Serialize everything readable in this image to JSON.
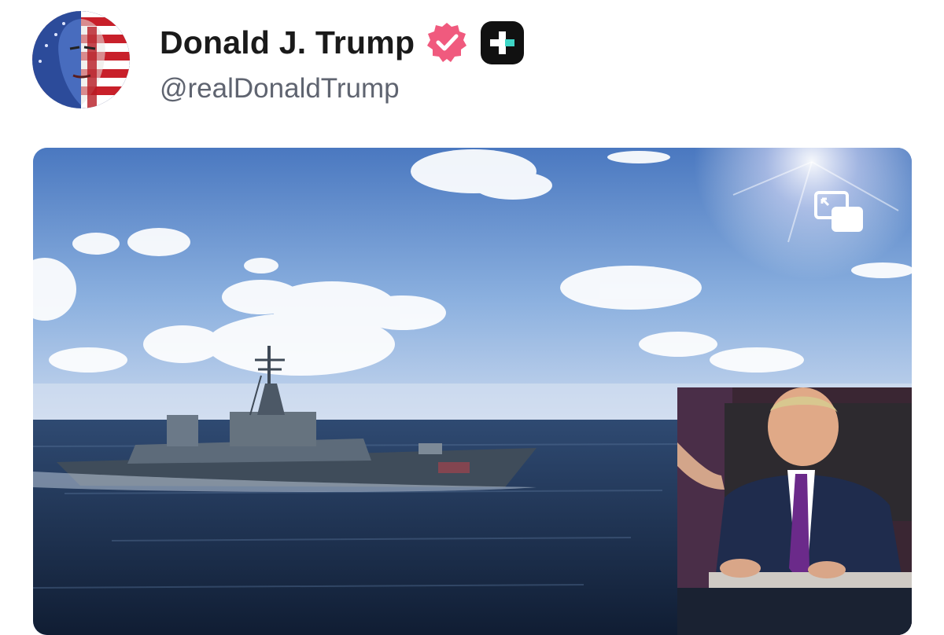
{
  "post": {
    "author": {
      "display_name": "Donald J. Trump",
      "handle": "@realDonaldTrump",
      "verified": true,
      "avatar_icon": "flag-portrait-avatar",
      "badge_icon": "truth-plus-icon"
    },
    "media": {
      "type": "video",
      "pip_icon": "picture-in-picture-icon"
    }
  },
  "colors": {
    "verified_badge": "#f05a7e",
    "name_text": "#1a1a1a",
    "handle_text": "#5f6470",
    "badge_dark": "#111111",
    "badge_accent": "#3fd6c6"
  }
}
